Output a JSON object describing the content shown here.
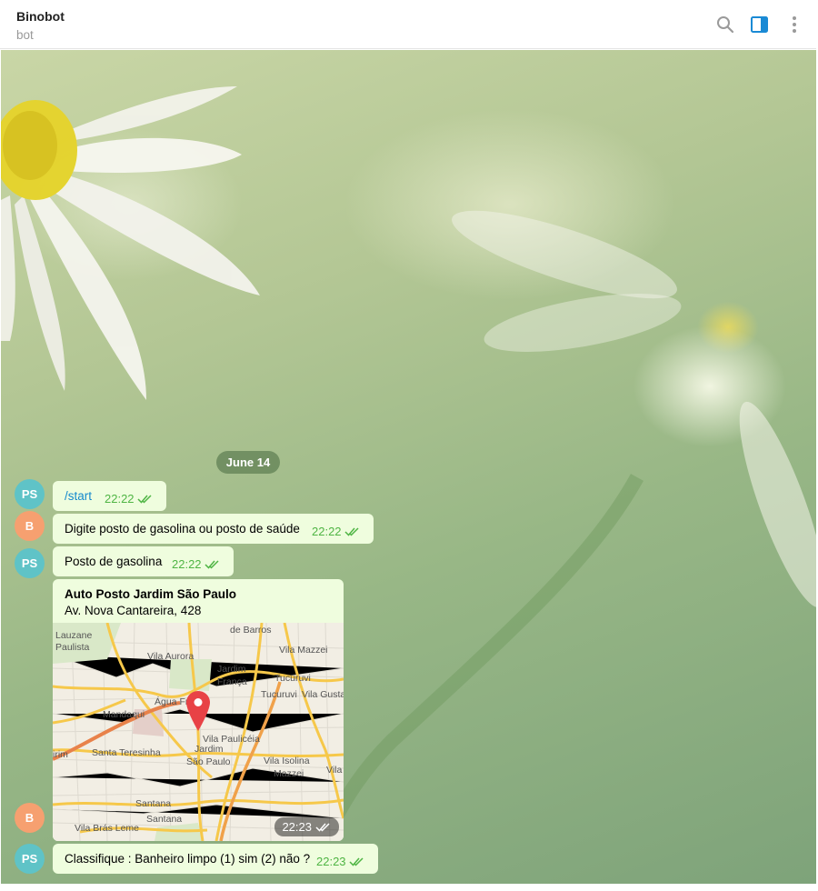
{
  "header": {
    "title": "Binobot",
    "subtitle": "bot",
    "icons": [
      "search-icon",
      "sidebar-toggle-icon",
      "more-vertical-icon"
    ],
    "accent": "#1a8ad5"
  },
  "chat": {
    "date_separator": "June 14",
    "messages": [
      {
        "avatar": "PS",
        "text": "/start",
        "time": "22:22"
      },
      {
        "avatar": "B",
        "text": "Digite posto de gasolina ou posto de saúde",
        "time": "22:22"
      },
      {
        "avatar": "PS",
        "text": "Posto de gasolina",
        "time": "22:22"
      },
      {
        "avatar": "B",
        "type": "location",
        "title": "Auto Posto Jardim São Paulo",
        "address": "Av. Nova Cantareira, 428",
        "time": "22:23",
        "map_labels": [
          "de Barros",
          "Lauzane",
          "Paulista",
          "Vila Aurora",
          "Vila Mazzei",
          "Jardim",
          "França",
          "Tucuruvi",
          "Água Fria",
          "Tucuruvi",
          "Vila Gusta",
          "Mandaqui",
          "Vila Paulicéia",
          "Jardim",
          "São Paulo",
          "Vila Isolina",
          "Mazzei",
          "Santa Teresinha",
          "irim",
          "Vila",
          "Santana",
          "Santana",
          "Vila Brás Leme"
        ]
      },
      {
        "avatar": "PS",
        "text": "Classifique : Banheiro limpo (1) sim (2) não ?",
        "time": "22:23"
      }
    ],
    "colors": {
      "bubble": "#effdde",
      "time": "#4fb544",
      "link": "#168acd",
      "avatar_ps": "#5fc3c7",
      "avatar_b": "#f6a070"
    }
  }
}
